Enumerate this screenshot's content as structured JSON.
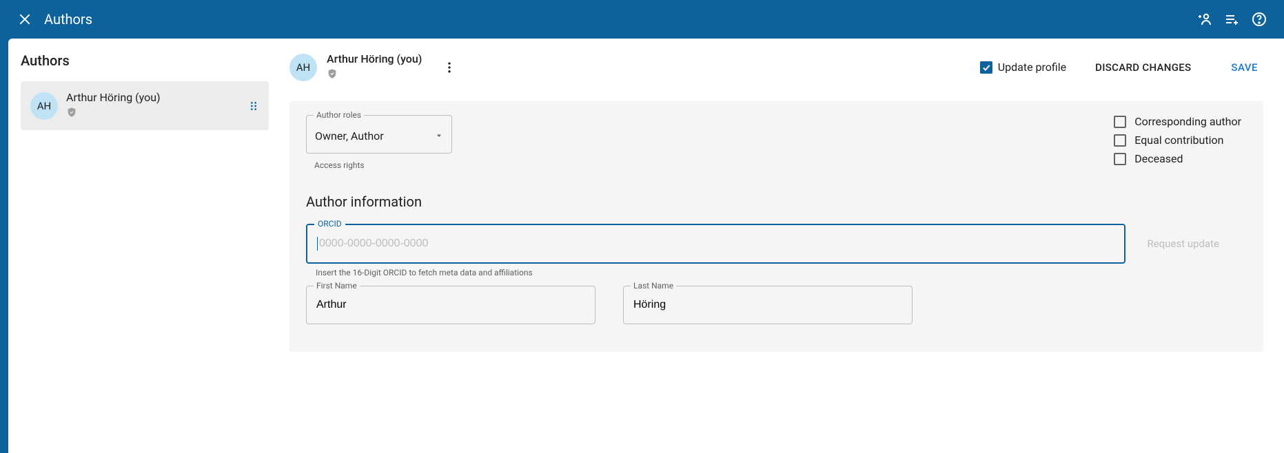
{
  "header": {
    "title": "Authors"
  },
  "sidebar": {
    "heading": "Authors",
    "author": {
      "initials": "AH",
      "name": "Arthur Höring (you)"
    }
  },
  "detail": {
    "avatar_initials": "AH",
    "name": "Arthur Höring (you)",
    "update_profile_label": "Update profile",
    "discard_label": "DISCARD CHANGES",
    "save_label": "SAVE",
    "roles_label": "Author roles",
    "roles_value": "Owner, Author",
    "access_rights_label": "Access rights",
    "flags": {
      "corresponding": "Corresponding author",
      "equal": "Equal contribution",
      "deceased": "Deceased"
    },
    "info_heading": "Author information",
    "orcid_label": "ORCID",
    "orcid_placeholder": "0000-0000-0000-0000",
    "orcid_value": "",
    "orcid_helper": "Insert the 16-Digit ORCID to fetch meta data and affiliations",
    "request_update": "Request update",
    "first_name_label": "First Name",
    "first_name_value": "Arthur",
    "last_name_label": "Last Name",
    "last_name_value": "Höring"
  }
}
